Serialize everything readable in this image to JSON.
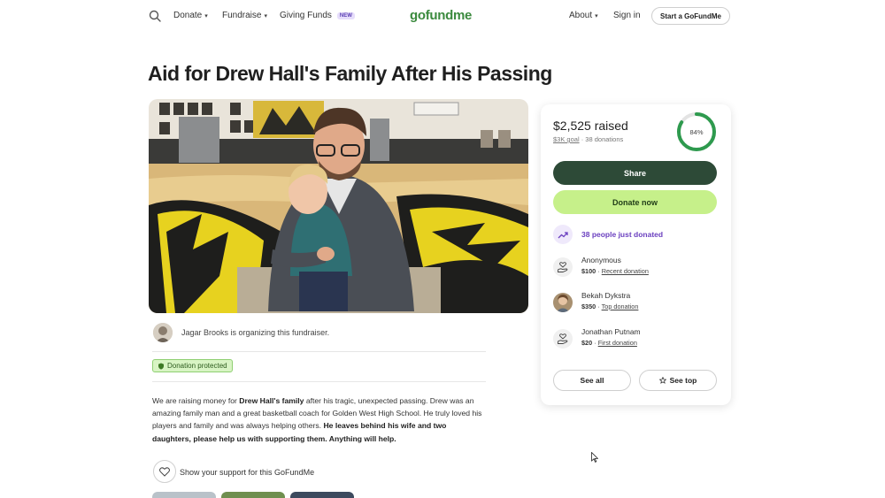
{
  "header": {
    "nav": [
      {
        "label": "Donate",
        "has_caret": true
      },
      {
        "label": "Fundraise",
        "has_caret": true
      },
      {
        "label": "Giving Funds",
        "badge": "NEW"
      }
    ],
    "logo": "gofundme",
    "right_nav": [
      {
        "label": "About",
        "has_caret": true
      },
      {
        "label": "Sign in"
      }
    ],
    "start_button": "Start a GoFundMe"
  },
  "campaign": {
    "title": "Aid for Drew Hall's Family After His Passing",
    "organizer_text": "Jagar Brooks is organizing this fundraiser.",
    "protected_label": "Donation protected",
    "description": {
      "p1_a": "We are raising money for ",
      "p1_bold": "Drew Hall's family",
      "p1_b": " after his tragic, unexpected passing. Drew was an amazing family man and a great basketball coach for Golden West High School. He truly loved his players and family and was always helping others. ",
      "p1_bold2": "He leaves behind his wife and two daughters, please help us with supporting them. Anything will help."
    },
    "support_text": "Show your support for this GoFundMe"
  },
  "donation_card": {
    "raised": "$2,525 raised",
    "goal": "$3K goal",
    "separator": "·",
    "donations": "38 donations",
    "progress_percent": 84,
    "progress_label": "84%",
    "share_label": "Share",
    "donate_label": "Donate now",
    "trend_text": "38 people just donated",
    "donors": [
      {
        "name": "Anonymous",
        "amount": "$100",
        "tag": "Recent donation",
        "avatar": "heart-hand"
      },
      {
        "name": "Bekah Dykstra",
        "amount": "$350",
        "tag": "Top donation",
        "avatar": "photo"
      },
      {
        "name": "Jonathan Putnam",
        "amount": "$20",
        "tag": "First donation",
        "avatar": "heart-hand"
      }
    ],
    "see_all_label": "See all",
    "see_top_label": "See top"
  },
  "colors": {
    "brand_green": "#3b8a3e",
    "share_bg": "#2d4a37",
    "donate_bg": "#c6f08a",
    "ring": "#2e9a4e",
    "trend_purple": "#6a3fbf"
  }
}
